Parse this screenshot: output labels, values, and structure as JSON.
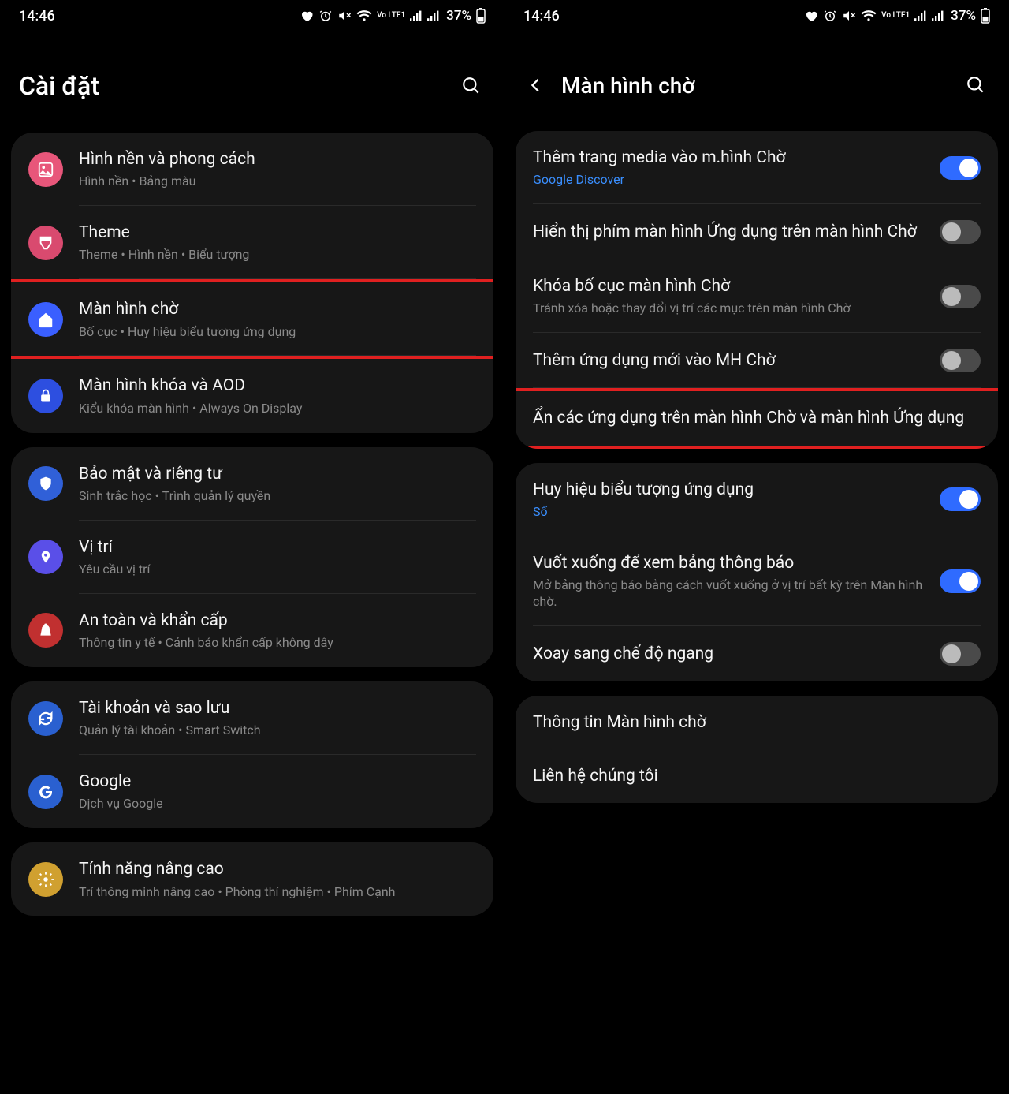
{
  "status": {
    "time": "14:46",
    "battery": "37%",
    "lte_label": "Vo LTE1"
  },
  "left": {
    "title": "Cài đặt",
    "groups": [
      {
        "items": [
          {
            "icon": "wallpaper",
            "color": "ic-pink",
            "title": "Hình nền và phong cách",
            "sub": "Hình nền  •  Bảng màu"
          },
          {
            "icon": "theme",
            "color": "ic-rose",
            "title": "Theme",
            "sub": "Theme  •  Hình nền  •  Biểu tượng"
          },
          {
            "icon": "home",
            "color": "ic-blue",
            "title": "Màn hình chờ",
            "sub": "Bố cục  •  Huy hiệu biểu tượng ứng dụng",
            "highlight": true
          },
          {
            "icon": "lock",
            "color": "ic-indigo",
            "title": "Màn hình khóa và AOD",
            "sub": "Kiểu khóa màn hình  •  Always On Display"
          }
        ]
      },
      {
        "items": [
          {
            "icon": "shield",
            "color": "ic-blue2",
            "title": "Bảo mật và riêng tư",
            "sub": "Sinh trắc học  •  Trình quản lý quyền"
          },
          {
            "icon": "location",
            "color": "ic-violet",
            "title": "Vị trí",
            "sub": "Yêu cầu vị trí"
          },
          {
            "icon": "emergency",
            "color": "ic-red",
            "title": "An toàn và khẩn cấp",
            "sub": "Thông tin y tế  •  Cảnh báo khẩn cấp không dây"
          }
        ]
      },
      {
        "items": [
          {
            "icon": "sync",
            "color": "ic-cyan",
            "title": "Tài khoản và sao lưu",
            "sub": "Quản lý tài khoản  •  Smart Switch"
          },
          {
            "icon": "google",
            "color": "ic-google",
            "title": "Google",
            "sub": "Dịch vụ Google"
          }
        ]
      },
      {
        "items": [
          {
            "icon": "advanced",
            "color": "ic-gold",
            "title": "Tính năng nâng cao",
            "sub": "Trí thông minh nâng cao  •  Phòng thí nghiệm  •  Phím Cạnh"
          }
        ]
      }
    ]
  },
  "right": {
    "title": "Màn hình chờ",
    "groups": [
      {
        "items": [
          {
            "title": "Thêm trang media vào m.hình Chờ",
            "sub": "Google Discover",
            "subBlue": true,
            "toggle": "on"
          },
          {
            "title": "Hiển thị phím màn hình Ứng dụng trên màn hình Chờ",
            "toggle": "off"
          },
          {
            "title": "Khóa bố cục màn hình Chờ",
            "sub": "Tránh xóa hoặc thay đổi vị trí các mục trên màn hình Chờ",
            "toggle": "off"
          },
          {
            "title": "Thêm ứng dụng mới vào MH Chờ",
            "toggle": "off"
          },
          {
            "title": "Ẩn các ứng dụng trên màn hình Chờ và màn hình Ứng dụng",
            "highlight": true
          }
        ]
      },
      {
        "items": [
          {
            "title": "Huy hiệu biểu tượng ứng dụng",
            "sub": "Số",
            "subBlue": true,
            "toggle": "on"
          },
          {
            "title": "Vuốt xuống để xem bảng thông báo",
            "sub": "Mở bảng thông báo bằng cách vuốt xuống ở vị trí bất kỳ trên Màn hình chờ.",
            "toggle": "on"
          },
          {
            "title": "Xoay sang chế độ ngang",
            "toggle": "off"
          }
        ]
      },
      {
        "items": [
          {
            "title": "Thông tin Màn hình chờ"
          },
          {
            "title": "Liên hệ chúng tôi"
          }
        ]
      }
    ]
  }
}
